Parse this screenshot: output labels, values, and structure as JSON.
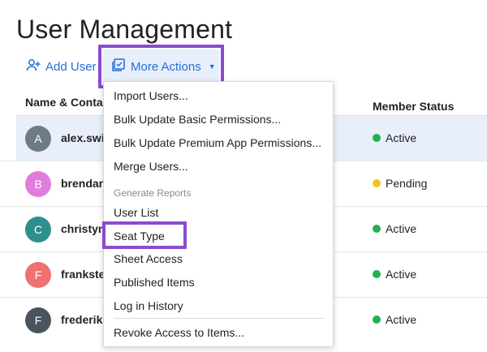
{
  "page": {
    "title": "User Management"
  },
  "toolbar": {
    "add_user": {
      "label": "Add User",
      "icon": "add-user-icon"
    },
    "more_actions": {
      "label": "More Actions",
      "icon": "checklist-icon"
    }
  },
  "table": {
    "columns": [
      "Name & Contact",
      "Member Status"
    ],
    "rows": [
      {
        "initial": "A",
        "name": "alex.swi",
        "status": "Active",
        "avatar_color": "#6f7a87",
        "status_color": "#23b14d"
      },
      {
        "initial": "B",
        "name": "brendan",
        "status": "Pending",
        "avatar_color": "#e07ddc",
        "status_color": "#f5c21b"
      },
      {
        "initial": "C",
        "name": "christym",
        "status": "Active",
        "avatar_color": "#2f8f8f",
        "status_color": "#23b14d"
      },
      {
        "initial": "F",
        "name": "frankste",
        "status": "Active",
        "avatar_color": "#ef7171",
        "status_color": "#23b14d"
      },
      {
        "initial": "F",
        "name": "frederik",
        "status": "Active",
        "avatar_color": "#4a545f",
        "status_color": "#23b14d"
      }
    ]
  },
  "menu": {
    "items_top": [
      "Import Users...",
      "Bulk Update Basic Permissions...",
      "Bulk Update Premium App Permissions...",
      "Merge Users..."
    ],
    "section_label": "Generate Reports",
    "report_items": [
      "User List",
      "Seat Type",
      "Sheet Access",
      "Published Items",
      "Log in History"
    ],
    "bottom_item": "Revoke Access to Items..."
  },
  "colors": {
    "accent": "#1f6fd6",
    "highlight": "#8c4ad0",
    "selected_row": "#e8effb"
  }
}
